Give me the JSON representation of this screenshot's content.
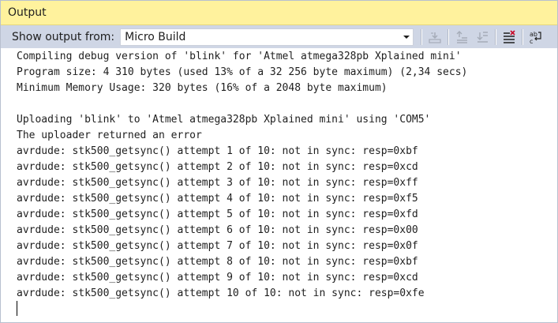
{
  "panel": {
    "title": "Output"
  },
  "toolbar": {
    "show_output_from_label": "Show output from:",
    "source_value": "Micro Build",
    "buttons": [
      {
        "icon": "find-message-in-code-icon",
        "enabled": false
      },
      {
        "icon": "go-to-previous-message-icon",
        "enabled": false
      },
      {
        "icon": "go-to-next-message-icon",
        "enabled": false
      },
      {
        "icon": "clear-all-icon",
        "enabled": true
      },
      {
        "icon": "toggle-word-wrap-icon",
        "enabled": true
      }
    ]
  },
  "output": {
    "lines": [
      "Compiling debug version of 'blink' for 'Atmel atmega328pb Xplained mini'",
      "Program size: 4 310 bytes (used 13% of a 32 256 byte maximum) (2,34 secs)",
      "Minimum Memory Usage: 320 bytes (16% of a 2048 byte maximum)",
      "",
      "Uploading 'blink' to 'Atmel atmega328pb Xplained mini' using 'COM5'",
      "The uploader returned an error",
      "avrdude: stk500_getsync() attempt 1 of 10: not in sync: resp=0xbf",
      "avrdude: stk500_getsync() attempt 2 of 10: not in sync: resp=0xcd",
      "avrdude: stk500_getsync() attempt 3 of 10: not in sync: resp=0xff",
      "avrdude: stk500_getsync() attempt 4 of 10: not in sync: resp=0xf5",
      "avrdude: stk500_getsync() attempt 5 of 10: not in sync: resp=0xfd",
      "avrdude: stk500_getsync() attempt 6 of 10: not in sync: resp=0x00",
      "avrdude: stk500_getsync() attempt 7 of 10: not in sync: resp=0x0f",
      "avrdude: stk500_getsync() attempt 8 of 10: not in sync: resp=0xbf",
      "avrdude: stk500_getsync() attempt 9 of 10: not in sync: resp=0xcd",
      "avrdude: stk500_getsync() attempt 10 of 10: not in sync: resp=0xfe"
    ]
  },
  "colors": {
    "title_bar": "#fff29d",
    "toolbar": "#cfd6e5",
    "clear_icon_red": "#c8102e"
  }
}
